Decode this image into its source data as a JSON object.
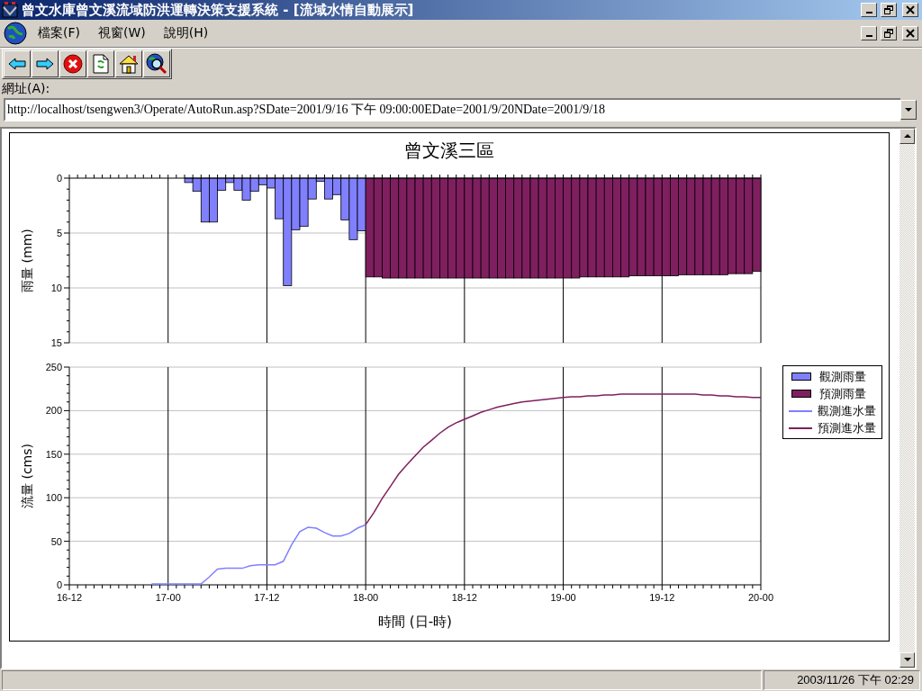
{
  "window": {
    "title": "曾文水庫曾文溪流域防洪運轉決策支援系統 - [流域水情自動展示]"
  },
  "menu": [
    {
      "label": "檔案(F)"
    },
    {
      "label": "視窗(W)"
    },
    {
      "label": "說明(H)"
    }
  ],
  "address": {
    "label": "網址(A):",
    "value": "http://localhost/tsengwen3/Operate/AutoRun.asp?SDate=2001/9/16 下午 09:00:00EDate=2001/9/20NDate=2001/9/18"
  },
  "chart": {
    "rainfall": {
      "chart_data": {
        "type": "bar",
        "title": "曾文溪三區",
        "ylabel": "雨量 (mm)",
        "ylim": [
          15,
          0
        ],
        "yticks": [
          0,
          5,
          10,
          15
        ],
        "grid": true,
        "series": [
          {
            "name": "觀測雨量",
            "color": "#8080ff",
            "values": [
              null,
              null,
              null,
              null,
              null,
              null,
              null,
              null,
              null,
              null,
              null,
              null,
              null,
              null,
              0.4,
              1.2,
              4.0,
              4.0,
              1.1,
              0.4,
              1.1,
              2.0,
              1.2,
              0.6,
              0.9,
              3.7,
              9.8,
              4.7,
              4.4,
              1.9,
              0.3,
              1.9,
              1.5,
              3.8,
              5.6,
              4.8,
              null,
              null,
              null,
              null,
              null,
              null,
              null,
              null,
              null,
              null,
              null,
              null,
              null,
              null,
              null,
              null,
              null,
              null,
              null,
              null,
              null,
              null,
              null,
              null,
              null,
              null,
              null,
              null,
              null,
              null,
              null,
              null,
              null,
              null,
              null,
              null,
              null,
              null,
              null,
              null,
              null,
              null,
              null,
              null,
              null,
              null,
              null,
              null
            ]
          },
          {
            "name": "預測雨量",
            "color": "#7f1f5f",
            "values": [
              null,
              null,
              null,
              null,
              null,
              null,
              null,
              null,
              null,
              null,
              null,
              null,
              null,
              null,
              null,
              null,
              null,
              null,
              null,
              null,
              null,
              null,
              null,
              null,
              null,
              null,
              null,
              null,
              null,
              null,
              null,
              null,
              null,
              null,
              null,
              null,
              9.0,
              9.0,
              9.1,
              9.1,
              9.1,
              9.1,
              9.1,
              9.1,
              9.1,
              9.1,
              9.1,
              9.1,
              9.1,
              9.1,
              9.1,
              9.1,
              9.1,
              9.1,
              9.1,
              9.1,
              9.1,
              9.1,
              9.1,
              9.1,
              9.1,
              9.1,
              9.0,
              9.0,
              9.0,
              9.0,
              9.0,
              9.0,
              8.9,
              8.9,
              8.9,
              8.9,
              8.9,
              8.9,
              8.8,
              8.8,
              8.8,
              8.8,
              8.8,
              8.8,
              8.7,
              8.7,
              8.7,
              8.5
            ]
          }
        ]
      }
    },
    "flow": {
      "chart_data": {
        "type": "line",
        "xlabel": "時間 (日-時)",
        "ylabel": "流量 (cms)",
        "ylim": [
          0,
          250
        ],
        "yticks": [
          0,
          50,
          100,
          150,
          200,
          250
        ],
        "grid": true,
        "categories": [
          "16-12",
          null,
          null,
          null,
          null,
          null,
          null,
          null,
          null,
          null,
          null,
          null,
          "17-00",
          null,
          null,
          null,
          null,
          null,
          null,
          null,
          null,
          null,
          null,
          null,
          "17-12",
          null,
          null,
          null,
          null,
          null,
          null,
          null,
          null,
          null,
          null,
          null,
          "18-00",
          null,
          null,
          null,
          null,
          null,
          null,
          null,
          null,
          null,
          null,
          null,
          "18-12",
          null,
          null,
          null,
          null,
          null,
          null,
          null,
          null,
          null,
          null,
          null,
          "19-00",
          null,
          null,
          null,
          null,
          null,
          null,
          null,
          null,
          null,
          null,
          null,
          "19-12",
          null,
          null,
          null,
          null,
          null,
          null,
          null,
          null,
          null,
          null,
          null,
          "20-00"
        ],
        "series": [
          {
            "name": "觀測進水量",
            "color": "#8080ff",
            "values": [
              null,
              null,
              null,
              null,
              null,
              null,
              null,
              null,
              null,
              null,
              0,
              0,
              0,
              0,
              0,
              0,
              0,
              8,
              17,
              18,
              18,
              18,
              21,
              22,
              22,
              22,
              26,
              45,
              60,
              65,
              64,
              59,
              55,
              55,
              58,
              64,
              68,
              null,
              null,
              null,
              null,
              null,
              null,
              null,
              null,
              null,
              null,
              null,
              null,
              null,
              null,
              null,
              null,
              null,
              null,
              null,
              null,
              null,
              null,
              null,
              null,
              null,
              null,
              null,
              null,
              null,
              null,
              null,
              null,
              null,
              null,
              null,
              null,
              null,
              null,
              null,
              null,
              null,
              null,
              null,
              null,
              null,
              null,
              null,
              null
            ]
          },
          {
            "name": "預測進水量",
            "color": "#7f1f5f",
            "values": [
              null,
              null,
              null,
              null,
              null,
              null,
              null,
              null,
              null,
              null,
              null,
              null,
              null,
              null,
              null,
              null,
              null,
              null,
              null,
              null,
              null,
              null,
              null,
              null,
              null,
              null,
              null,
              null,
              null,
              null,
              null,
              null,
              null,
              null,
              null,
              null,
              68,
              82,
              98,
              112,
              126,
              137,
              147,
              157,
              165,
              173,
              180,
              185,
              189,
              193,
              197,
              200,
              203,
              205,
              207,
              209,
              210,
              211,
              212,
              213,
              214,
              215,
              215,
              216,
              216,
              217,
              217,
              218,
              218,
              218,
              218,
              218,
              218,
              218,
              218,
              218,
              218,
              217,
              217,
              216,
              216,
              215,
              215,
              214,
              214
            ]
          }
        ]
      }
    }
  },
  "status_bar": {
    "datetime": "2003/11/26 下午 02:29"
  }
}
